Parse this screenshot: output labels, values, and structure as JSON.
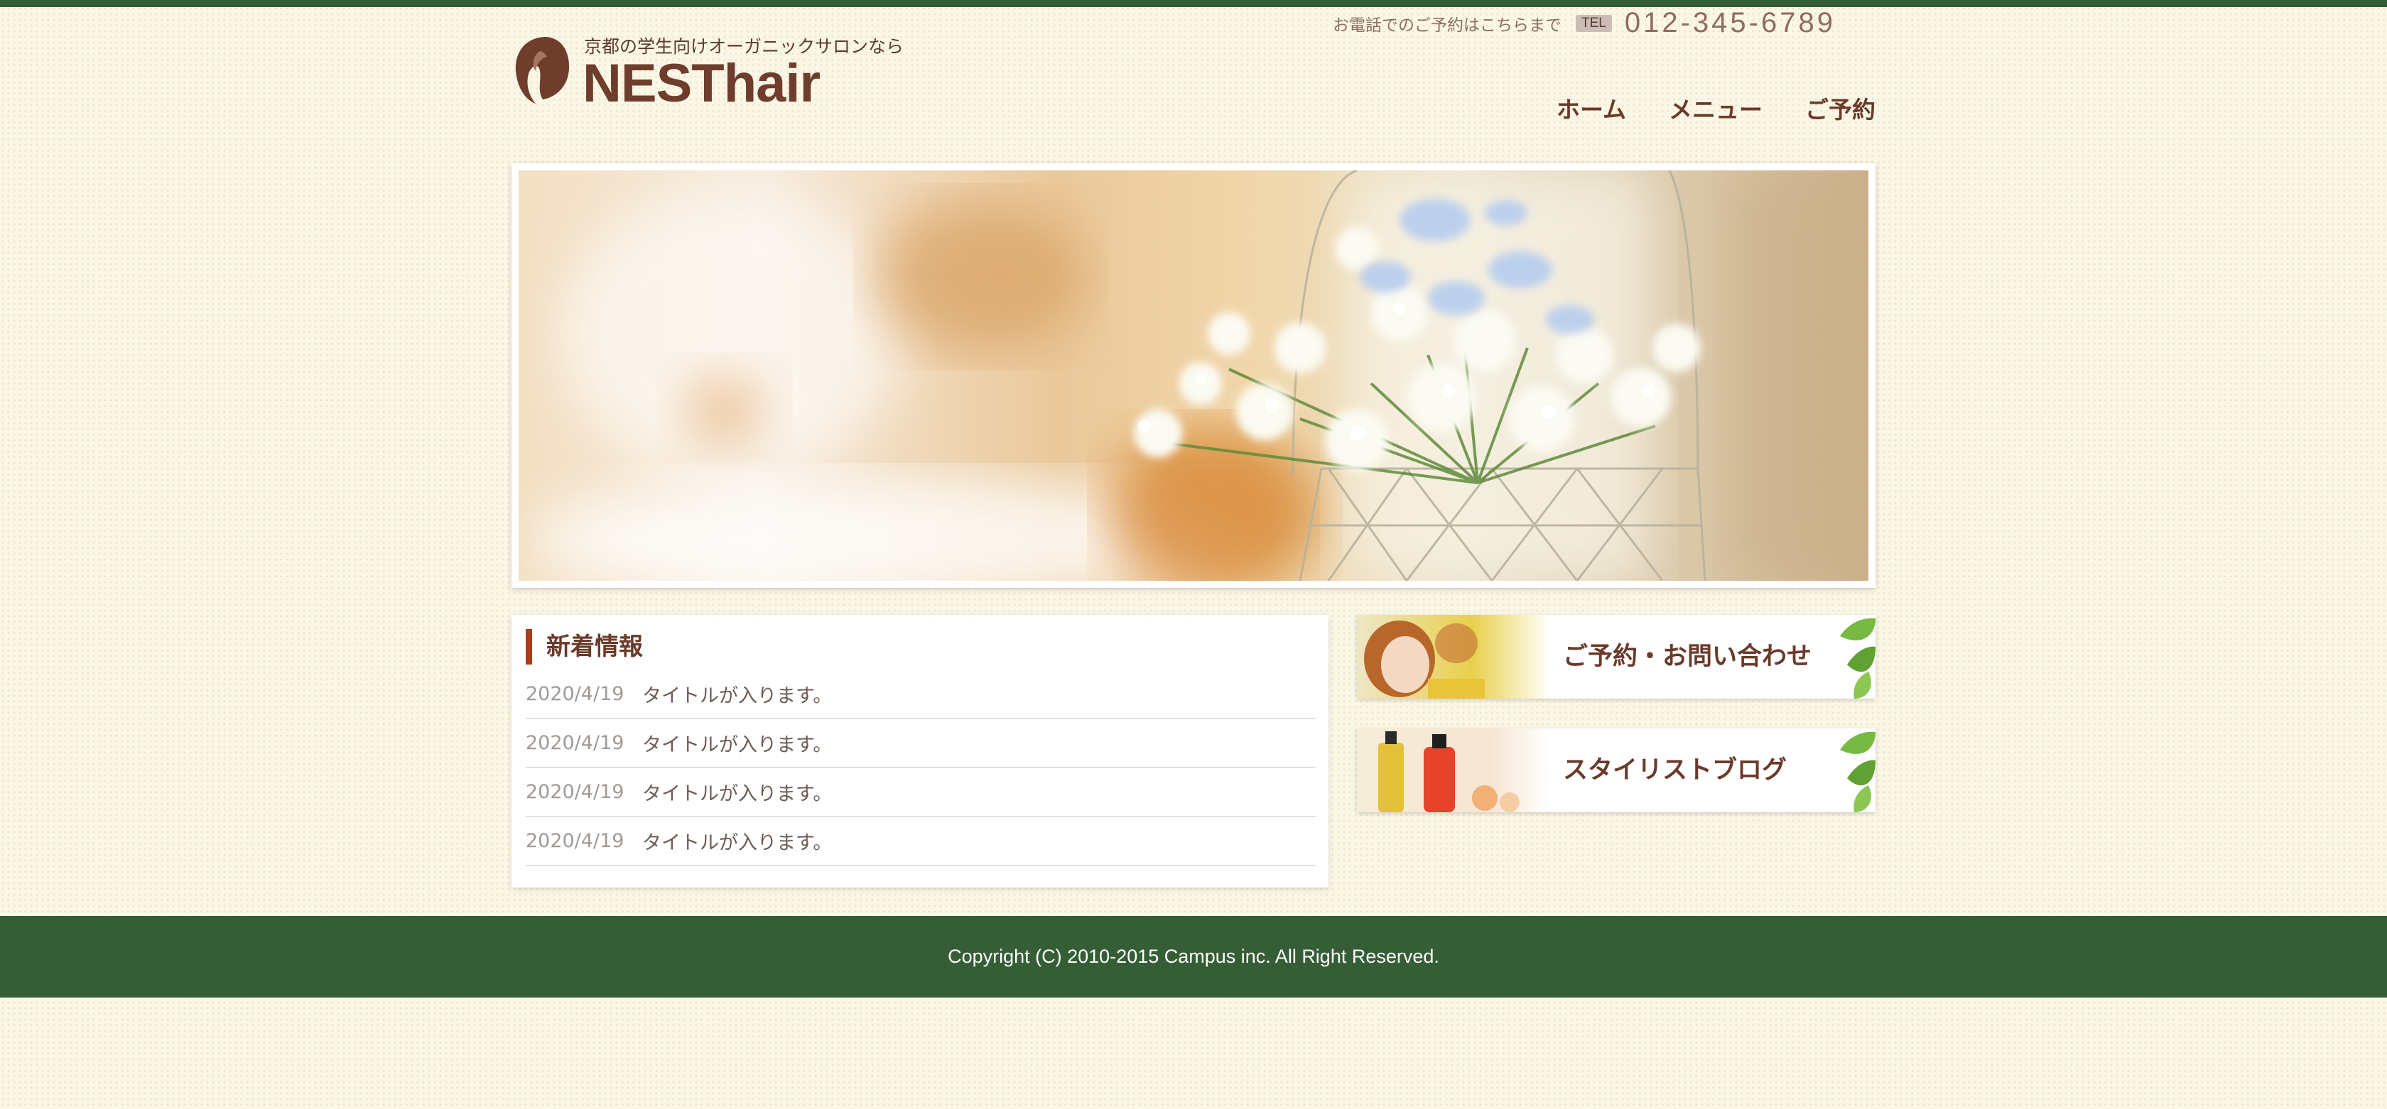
{
  "header": {
    "tagline": "京都の学生向けオーガニックサロンなら",
    "site_name": "NESThair",
    "phone_note": "お電話でのご予約はこちらまで",
    "tel_label": "TEL",
    "tel_number": "012-345-6789"
  },
  "nav": {
    "items": [
      {
        "label": "ホーム"
      },
      {
        "label": "メニュー"
      },
      {
        "label": "ご予約"
      }
    ]
  },
  "news": {
    "title": "新着情報",
    "items": [
      {
        "date": "2020/4/19",
        "title": "タイトルが入ります。"
      },
      {
        "date": "2020/4/19",
        "title": "タイトルが入ります。"
      },
      {
        "date": "2020/4/19",
        "title": "タイトルが入ります。"
      },
      {
        "date": "2020/4/19",
        "title": "タイトルが入ります。"
      }
    ]
  },
  "banners": {
    "reservation": "ご予約・お問い合わせ",
    "blog": "スタイリストブログ"
  },
  "footer": {
    "copyright": "Copyright (C) 2010-2015 Campus inc. All Right Reserved."
  },
  "colors": {
    "accent_green": "#355e36",
    "brand_brown": "#6e3d2c",
    "heading_bar": "#b03a1c",
    "background": "#fbf7e6"
  },
  "icons": {
    "logo": "hair-silhouette-icon",
    "banner_decoration": "leaf-icon"
  }
}
